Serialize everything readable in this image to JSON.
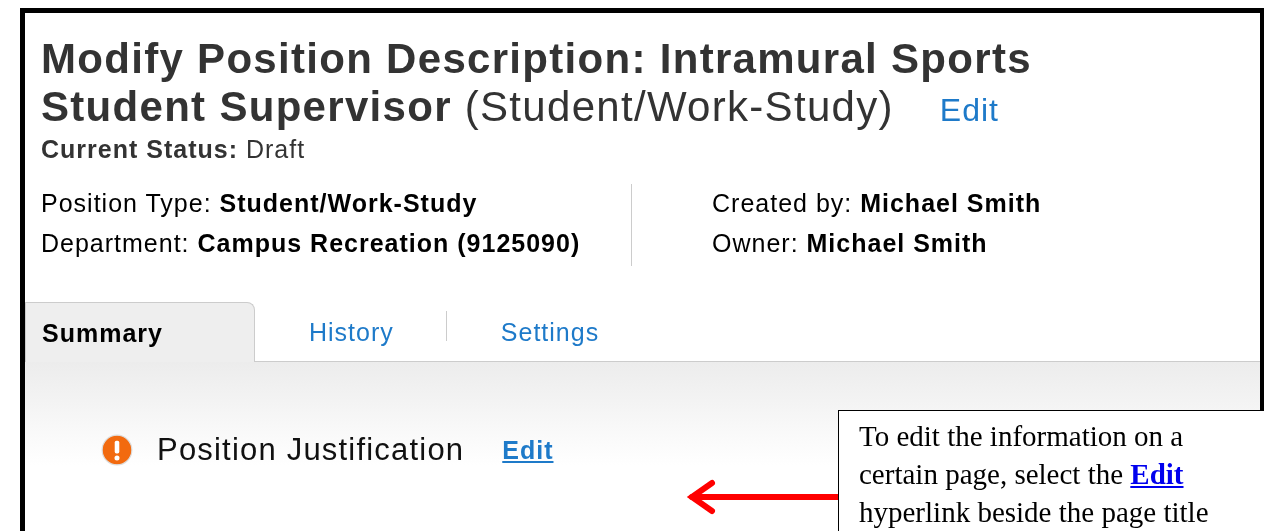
{
  "header": {
    "title_line_1": "Modify Position Description: Intramural Sports",
    "title_line_2": "**Student Supervisor** (Student/Work-Study)",
    "edit_link": "Edit",
    "status": "**Current Status:** Draft"
  },
  "details": {
    "left": [
      "Position Type: **Student/Work-Study**",
      "Department: **Campus Recreation (9125090)**"
    ],
    "right": [
      "Created by: **Michael Smith**",
      "Owner: **Michael Smith**"
    ]
  },
  "tabs": [
    {
      "label": "Summary",
      "selected": true
    },
    {
      "label": "History",
      "selected": false
    },
    {
      "label": "Settings",
      "selected": false
    }
  ],
  "section": {
    "title": "Position Justification",
    "edit_link": "Edit"
  },
  "callout": {
    "line_1": "To edit the information on a",
    "line_2": "certain page, select the",
    "link": "Edit",
    "line_3": "hyperlink beside the page title"
  }
}
